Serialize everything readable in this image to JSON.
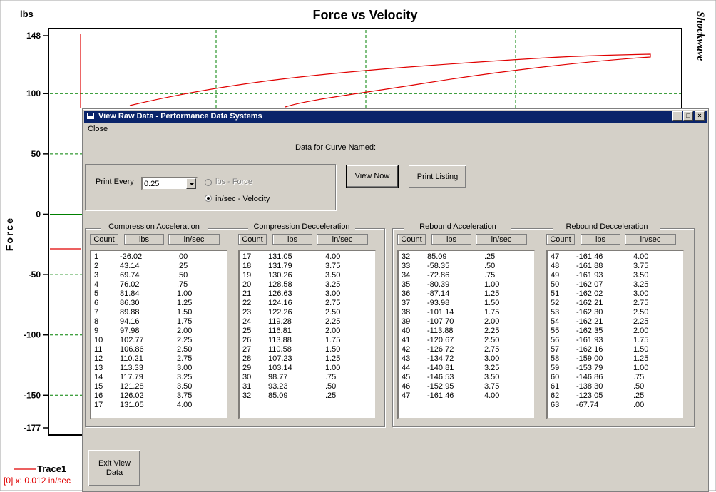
{
  "chart": {
    "title": "Force vs Velocity",
    "unit_label": "lbs",
    "y_axis_label": "Force",
    "y_ticks": [
      "148",
      "100",
      "50",
      "0",
      "-50",
      "-100",
      "-150",
      "-177"
    ],
    "legend_label": "Trace1",
    "cursor_readout": "[0] x: 0.012 in/sec",
    "brand": "Shockwave",
    "colors": {
      "trace": "#e00000",
      "grid": "#008000",
      "axis": "#000000"
    }
  },
  "chart_data": {
    "type": "line",
    "title": "Force vs Velocity",
    "ylabel": "Force",
    "yunit": "lbs",
    "ylim": [
      -177,
      148
    ],
    "yticks": [
      148,
      100,
      50,
      0,
      -50,
      -100,
      -150,
      -177
    ],
    "series": [
      {
        "name": "Trace1",
        "color": "#e00000"
      }
    ]
  },
  "window": {
    "title": "View Raw Data - Performance Data Systems",
    "menu": {
      "close": "Close"
    },
    "heading": "Data for Curve Named:",
    "print_every_label": "Print Every",
    "print_every_value": "0.25",
    "radio_force": "lbs - Force",
    "radio_velocity": "in/sec - Velocity",
    "view_now": "View Now",
    "print_listing": "Print Listing",
    "exit_view": "Exit View Data",
    "col_count": "Count",
    "col_lbs": "lbs",
    "col_insec": "in/sec"
  },
  "lists": [
    {
      "title": "Compression Acceleration",
      "rows": [
        [
          "1",
          "-26.02",
          ".00"
        ],
        [
          "2",
          "43.14",
          ".25"
        ],
        [
          "3",
          "69.74",
          ".50"
        ],
        [
          "4",
          "76.02",
          ".75"
        ],
        [
          "5",
          "81.84",
          "1.00"
        ],
        [
          "6",
          "86.30",
          "1.25"
        ],
        [
          "7",
          "89.88",
          "1.50"
        ],
        [
          "8",
          "94.16",
          "1.75"
        ],
        [
          "9",
          "97.98",
          "2.00"
        ],
        [
          "10",
          "102.77",
          "2.25"
        ],
        [
          "11",
          "106.86",
          "2.50"
        ],
        [
          "12",
          "110.21",
          "2.75"
        ],
        [
          "13",
          "113.33",
          "3.00"
        ],
        [
          "14",
          "117.79",
          "3.25"
        ],
        [
          "15",
          "121.28",
          "3.50"
        ],
        [
          "16",
          "126.02",
          "3.75"
        ],
        [
          "17",
          "131.05",
          "4.00"
        ]
      ]
    },
    {
      "title": "Compression Decceleration",
      "rows": [
        [
          "17",
          "131.05",
          "4.00"
        ],
        [
          "18",
          "131.79",
          "3.75"
        ],
        [
          "19",
          "130.26",
          "3.50"
        ],
        [
          "20",
          "128.58",
          "3.25"
        ],
        [
          "21",
          "126.63",
          "3.00"
        ],
        [
          "22",
          "124.16",
          "2.75"
        ],
        [
          "23",
          "122.26",
          "2.50"
        ],
        [
          "24",
          "119.28",
          "2.25"
        ],
        [
          "25",
          "116.81",
          "2.00"
        ],
        [
          "26",
          "113.88",
          "1.75"
        ],
        [
          "27",
          "110.58",
          "1.50"
        ],
        [
          "28",
          "107.23",
          "1.25"
        ],
        [
          "29",
          "103.14",
          "1.00"
        ],
        [
          "30",
          "98.77",
          ".75"
        ],
        [
          "31",
          "93.23",
          ".50"
        ],
        [
          "32",
          "85.09",
          ".25"
        ]
      ]
    },
    {
      "title": "Rebound Acceleration",
      "rows": [
        [
          "32",
          "85.09",
          ".25"
        ],
        [
          "33",
          "-58.35",
          ".50"
        ],
        [
          "34",
          "-72.86",
          ".75"
        ],
        [
          "35",
          "-80.39",
          "1.00"
        ],
        [
          "36",
          "-87.14",
          "1.25"
        ],
        [
          "37",
          "-93.98",
          "1.50"
        ],
        [
          "38",
          "-101.14",
          "1.75"
        ],
        [
          "39",
          "-107.70",
          "2.00"
        ],
        [
          "40",
          "-113.88",
          "2.25"
        ],
        [
          "41",
          "-120.67",
          "2.50"
        ],
        [
          "42",
          "-126.72",
          "2.75"
        ],
        [
          "43",
          "-134.72",
          "3.00"
        ],
        [
          "44",
          "-140.81",
          "3.25"
        ],
        [
          "45",
          "-146.53",
          "3.50"
        ],
        [
          "46",
          "-152.95",
          "3.75"
        ],
        [
          "47",
          "-161.46",
          "4.00"
        ]
      ]
    },
    {
      "title": "Rebound Decceleration",
      "rows": [
        [
          "47",
          "-161.46",
          "4.00"
        ],
        [
          "48",
          "-161.88",
          "3.75"
        ],
        [
          "49",
          "-161.93",
          "3.50"
        ],
        [
          "50",
          "-162.07",
          "3.25"
        ],
        [
          "51",
          "-162.02",
          "3.00"
        ],
        [
          "52",
          "-162.21",
          "2.75"
        ],
        [
          "53",
          "-162.30",
          "2.50"
        ],
        [
          "54",
          "-162.21",
          "2.25"
        ],
        [
          "55",
          "-162.35",
          "2.00"
        ],
        [
          "56",
          "-161.93",
          "1.75"
        ],
        [
          "57",
          "-162.16",
          "1.50"
        ],
        [
          "58",
          "-159.00",
          "1.25"
        ],
        [
          "59",
          "-153.79",
          "1.00"
        ],
        [
          "60",
          "-146.86",
          ".75"
        ],
        [
          "61",
          "-138.30",
          ".50"
        ],
        [
          "62",
          "-123.05",
          ".25"
        ],
        [
          "63",
          "-67.74",
          ".00"
        ]
      ]
    }
  ]
}
